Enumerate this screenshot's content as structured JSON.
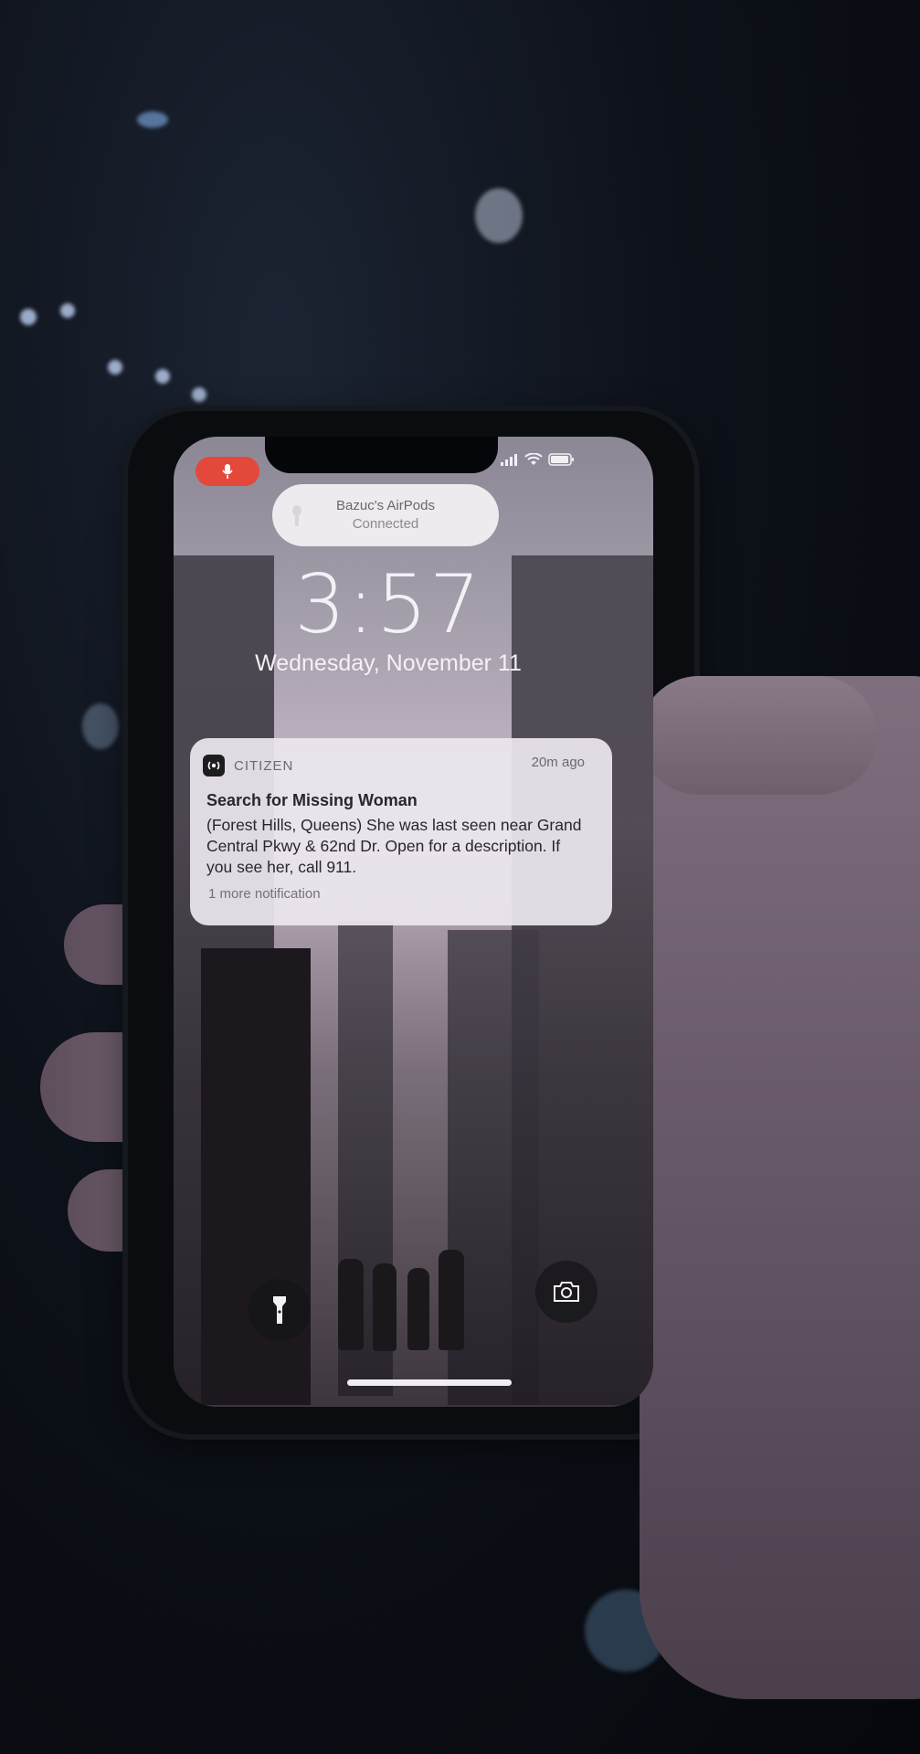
{
  "status_bar": {
    "mic_indicator_icon": "microphone-icon",
    "signal_icon": "cellular-signal-icon",
    "wifi_icon": "wifi-icon",
    "battery_icon": "battery-icon"
  },
  "airpods_banner": {
    "device": "Bazuc's AirPods",
    "status": "Connected",
    "icon": "airpods-icon"
  },
  "lock_screen": {
    "time": "3:57",
    "date": "Wednesday, November 11"
  },
  "notification": {
    "app_name": "CITIZEN",
    "timestamp": "20m ago",
    "title": "Search for Missing Woman",
    "body": "(Forest Hills, Queens) She was last seen near Grand Central Pkwy & 62nd Dr. Open for a description. If you see her, call 911.",
    "more": "1 more notification"
  },
  "quick_actions": {
    "left": "flashlight-icon",
    "right": "camera-icon"
  },
  "colors": {
    "mic_indicator": "#e3483a",
    "notification_bg": "#ece6ee"
  }
}
